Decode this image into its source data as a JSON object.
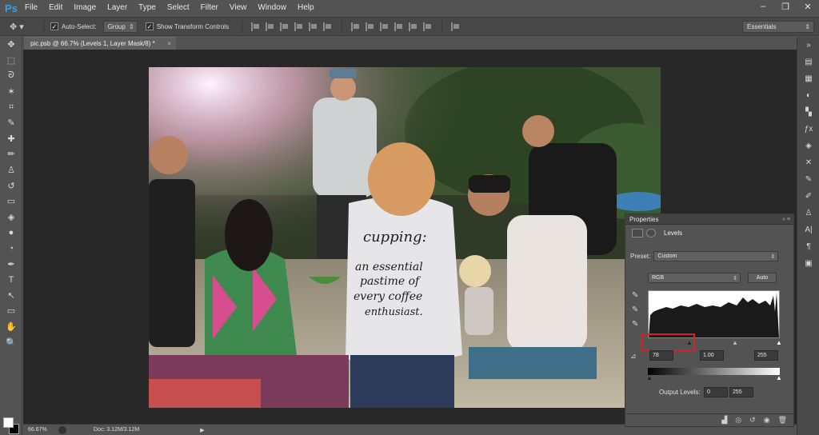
{
  "app": {
    "logo": "Ps",
    "brand_color": "#2fa3e6"
  },
  "menu": [
    "File",
    "Edit",
    "Image",
    "Layer",
    "Type",
    "Select",
    "Filter",
    "View",
    "Window",
    "Help"
  ],
  "window_controls": [
    "–",
    "❐",
    "✕"
  ],
  "options_bar": {
    "auto_select_label": "Auto-Select:",
    "auto_select_value": "Group",
    "show_transform_label": "Show Transform Controls",
    "workspace": "Essentials"
  },
  "document": {
    "tab_title": "pic.psb @ 66.7% (Levels 1, Layer Mask/8) *",
    "tab_close": "×"
  },
  "status": {
    "zoom": "66.67%",
    "doc_info": "Doc: 3.12M/3.12M"
  },
  "photo_text": {
    "shirt_lines": [
      "cupping:",
      "an essential",
      "pastime of",
      "every coffee",
      "enthusiast."
    ]
  },
  "properties": {
    "panel_title": "Properties",
    "adjustment_name": "Levels",
    "preset_label": "Preset:",
    "preset_value": "Custom",
    "channel_value": "RGB",
    "auto_button": "Auto",
    "input_black": "78",
    "input_gamma": "1.00",
    "input_white": "255",
    "output_label": "Output Levels:",
    "output_black": "0",
    "output_white": "255"
  },
  "icons": {
    "move": "✥",
    "marquee": "⬚",
    "lasso": "ᘐ",
    "wand": "✶",
    "crop": "⌗",
    "eyedropper": "✎",
    "heal": "✚",
    "brush": "✏",
    "stamp": "♙",
    "history": "↺",
    "eraser": "▭",
    "bucket": "◈",
    "blur": "●",
    "dodge": "◔",
    "pen": "✒",
    "type": "T",
    "path": "↖",
    "shape": "▭",
    "hand": "✋",
    "zoom": "🔍"
  }
}
